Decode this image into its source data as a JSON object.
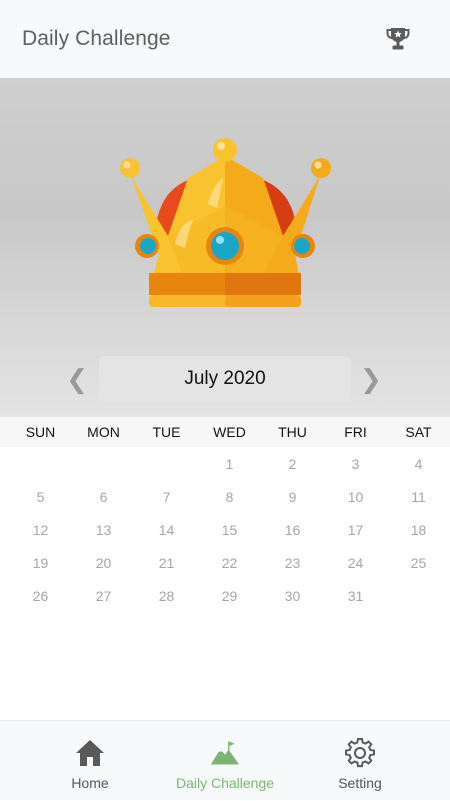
{
  "header": {
    "title": "Daily Challenge",
    "trophy_icon": "trophy-icon"
  },
  "hero": {
    "crown_icon": "crown-illustration",
    "month_label": "July 2020",
    "prev_glyph": "❮",
    "next_glyph": "❯"
  },
  "calendar": {
    "weekdays": [
      "SUN",
      "MON",
      "TUE",
      "WED",
      "THU",
      "FRI",
      "SAT"
    ],
    "days": [
      "",
      "",
      "",
      "1",
      "2",
      "3",
      "4",
      "5",
      "6",
      "7",
      "8",
      "9",
      "10",
      "11",
      "12",
      "13",
      "14",
      "15",
      "16",
      "17",
      "18",
      "19",
      "20",
      "21",
      "22",
      "23",
      "24",
      "25",
      "26",
      "27",
      "28",
      "29",
      "30",
      "31",
      ""
    ]
  },
  "bottom_nav": {
    "home_label": "Home",
    "daily_label": "Daily Challenge",
    "setting_label": "Setting",
    "active": "Daily Challenge",
    "active_color": "#7cb572"
  },
  "colors": {
    "header_bg": "#f8f9fb",
    "day_text": "#a6a6a6",
    "accent_green": "#7cb572"
  }
}
